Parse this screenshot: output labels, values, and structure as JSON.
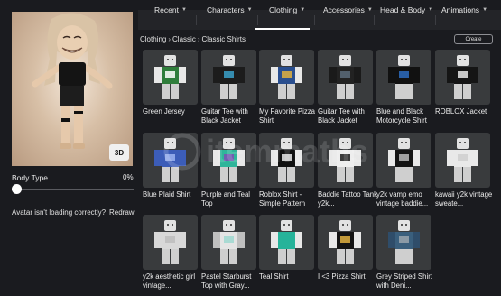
{
  "avatar": {
    "view_3d_label": "3D",
    "body_type_label": "Body Type",
    "body_type_value": "0%",
    "body_type_fraction": 0,
    "loading_hint": "Avatar isn't loading correctly?",
    "redraw_label": "Redraw"
  },
  "tabs": [
    {
      "label": "Recent",
      "active": false
    },
    {
      "label": "Characters",
      "active": false
    },
    {
      "label": "Clothing",
      "active": true
    },
    {
      "label": "Accessories",
      "active": false
    },
    {
      "label": "Head & Body",
      "active": false
    },
    {
      "label": "Animations",
      "active": false
    }
  ],
  "breadcrumb": [
    "Clothing",
    "Classic",
    "Classic Shirts"
  ],
  "create_label": "Create",
  "watermark_text": "itemmaths",
  "items": [
    {
      "name": "Green Jersey",
      "colors": {
        "torso": "#2f7d3b",
        "arm": "#e8e8e8",
        "accent": "#ffffff"
      }
    },
    {
      "name": "Guitar Tee with Black Jacket",
      "colors": {
        "torso": "#1c1c1c",
        "arm": "#1c1c1c",
        "accent": "#3aa0c8"
      }
    },
    {
      "name": "My Favorite Pizza Shirt",
      "colors": {
        "torso": "#2a4f8f",
        "arm": "#e8e8e8",
        "accent": "#e0b040"
      }
    },
    {
      "name": "Guitar Tee with Black Jacket",
      "colors": {
        "torso": "#222222",
        "arm": "#1a1a1a",
        "accent": "#5a6b7a"
      }
    },
    {
      "name": "Blue and Black Motorcycle Shirt",
      "colors": {
        "torso": "#111111",
        "arm": "#111111",
        "accent": "#2d6cc0"
      }
    },
    {
      "name": "ROBLOX Jacket",
      "colors": {
        "torso": "#151515",
        "arm": "#151515",
        "accent": "#e8e8e8"
      }
    },
    {
      "name": "Blue Plaid Shirt",
      "colors": {
        "torso": "#3c5db8",
        "arm": "#3c5db8",
        "accent": "#9bb3f0"
      }
    },
    {
      "name": "Purple and Teal Top",
      "colors": {
        "torso": "#2fb59a",
        "arm": "#e8e8e8",
        "accent": "#7b4fb5"
      }
    },
    {
      "name": "Roblox Shirt - Simple Pattern",
      "colors": {
        "torso": "#111111",
        "arm": "#e8e8e8",
        "accent": "#e8e8e8"
      }
    },
    {
      "name": "Baddie Tattoo Tank y2k...",
      "colors": {
        "torso": "#eeeeee",
        "arm": "#e8e8e8",
        "accent": "#1a1a1a"
      }
    },
    {
      "name": "y2k vamp emo vintage baddie...",
      "colors": {
        "torso": "#141414",
        "arm": "#e8e8e8",
        "accent": "#b8b8b8"
      }
    },
    {
      "name": "kawaii y2k vintage sweate...",
      "colors": {
        "torso": "#e9e9e9",
        "arm": "#e9e9e9",
        "accent": "#cfcfcf"
      }
    },
    {
      "name": "y2k aesthetic girl vintage...",
      "colors": {
        "torso": "#d8d8d8",
        "arm": "#d8d8d8",
        "accent": "#bdbdbd"
      }
    },
    {
      "name": "Pastel Starburst Top with Gray...",
      "colors": {
        "torso": "#e4e4e4",
        "arm": "#bfbfbf",
        "accent": "#9fd8d0"
      }
    },
    {
      "name": "Teal Shirt",
      "colors": {
        "torso": "#26b39a",
        "arm": "#e8e8e8",
        "accent": "#26b39a"
      }
    },
    {
      "name": "I <3 Pizza Shirt",
      "colors": {
        "torso": "#141414",
        "arm": "#e8e8e8",
        "accent": "#e0b040"
      }
    },
    {
      "name": "Grey Striped Shirt with Deni...",
      "colors": {
        "torso": "#3a5f7d",
        "arm": "#2f4d6a",
        "accent": "#9aa4ad"
      }
    }
  ]
}
